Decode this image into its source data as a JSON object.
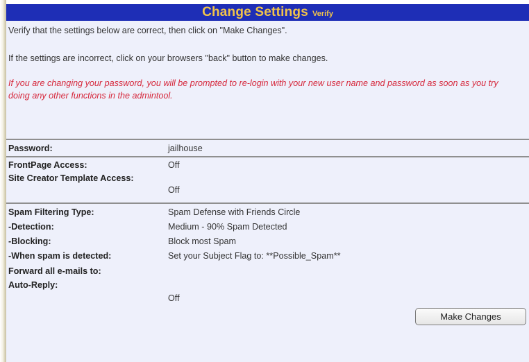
{
  "header": {
    "title": "Change Settings",
    "subtitle": "Verify"
  },
  "messages": {
    "verify": "Verify that the settings below are correct, then click on \"Make Changes\".",
    "incorrect": "If the settings are incorrect, click on your browsers \"back\" button to make changes.",
    "warning": "If you are changing your password, you will be prompted to re-login with your new user name and password as soon as you try doing any other functions in the admintool."
  },
  "settings": {
    "password": {
      "label": "Password:",
      "value": "jailhouse"
    },
    "frontpage": {
      "label": "FrontPage Access:",
      "value": "Off"
    },
    "site_creator": {
      "label": "Site Creator Template Access:",
      "value": "Off"
    },
    "spam_type": {
      "label": "Spam Filtering Type:",
      "value": "Spam Defense with Friends Circle"
    },
    "detection": {
      "label": "-Detection:",
      "value": "Medium - 90% Spam Detected"
    },
    "blocking": {
      "label": "-Blocking:",
      "value": "Block most Spam"
    },
    "when_detected": {
      "label": "-When spam is detected:",
      "value": "Set your Subject Flag to: **Possible_Spam**"
    },
    "forward": {
      "label": "Forward all e-mails to:",
      "value": ""
    },
    "autoreply": {
      "label": "Auto-Reply:",
      "value": "Off"
    }
  },
  "actions": {
    "make_changes": "Make Changes"
  },
  "colors": {
    "header_bg": "#1e2eb6",
    "header_text": "#f2c44a",
    "warning": "#d6283c",
    "panel_bg": "#eef0fb"
  }
}
